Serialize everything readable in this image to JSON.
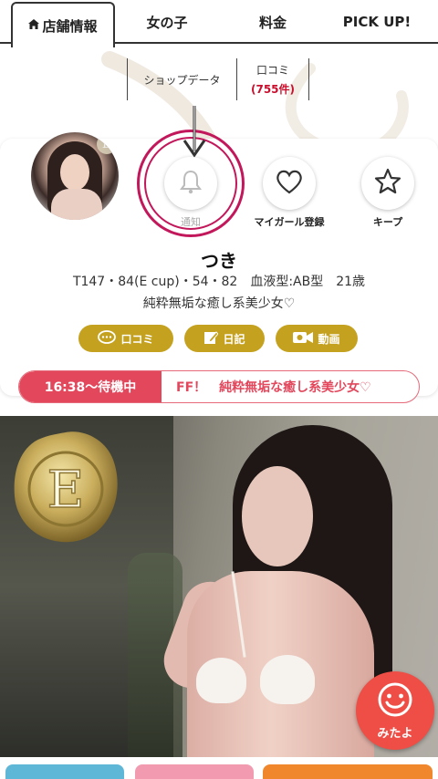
{
  "tabs": [
    {
      "label": "店舗情報",
      "icon": "home-icon",
      "active": true
    },
    {
      "label": "女の子",
      "active": false
    },
    {
      "label": "料金",
      "active": false
    },
    {
      "label": "PICK UP!",
      "active": false
    }
  ],
  "subtabs": [
    {
      "label": "ショップデータ"
    },
    {
      "label": "口コミ",
      "count": "(755件)"
    }
  ],
  "profile": {
    "name": "つき",
    "specs": "T147・84(E cup)・54・82　血液型:AB型　21歳",
    "catchphrase": "純粋無垢な癒し系美少女♡",
    "avatar_badge": "E"
  },
  "actions": [
    {
      "label": "通知",
      "icon": "bell-icon",
      "highlighted": true
    },
    {
      "label": "マイガール登録",
      "icon": "heart-icon"
    },
    {
      "label": "キープ",
      "icon": "star-icon"
    }
  ],
  "pills": [
    {
      "label": "口コミ",
      "icon": "chat-bubble-icon"
    },
    {
      "label": "日記",
      "icon": "edit-note-icon"
    },
    {
      "label": "動画",
      "icon": "video-camera-icon"
    }
  ],
  "ticker": {
    "time": "16:38～待機中",
    "message": "FF！　純粋無垢な癒し系美少女♡"
  },
  "photo": {
    "seal_letter": "E"
  },
  "mitayo": {
    "label": "みたよ",
    "icon": "smiley-icon"
  },
  "colors": {
    "accent_gold": "#c4a11f",
    "ticker_red": "#e2475c",
    "highlight_ring": "#c2185b",
    "mitayo_red": "#ee4e45",
    "count_red": "#c8102e"
  }
}
